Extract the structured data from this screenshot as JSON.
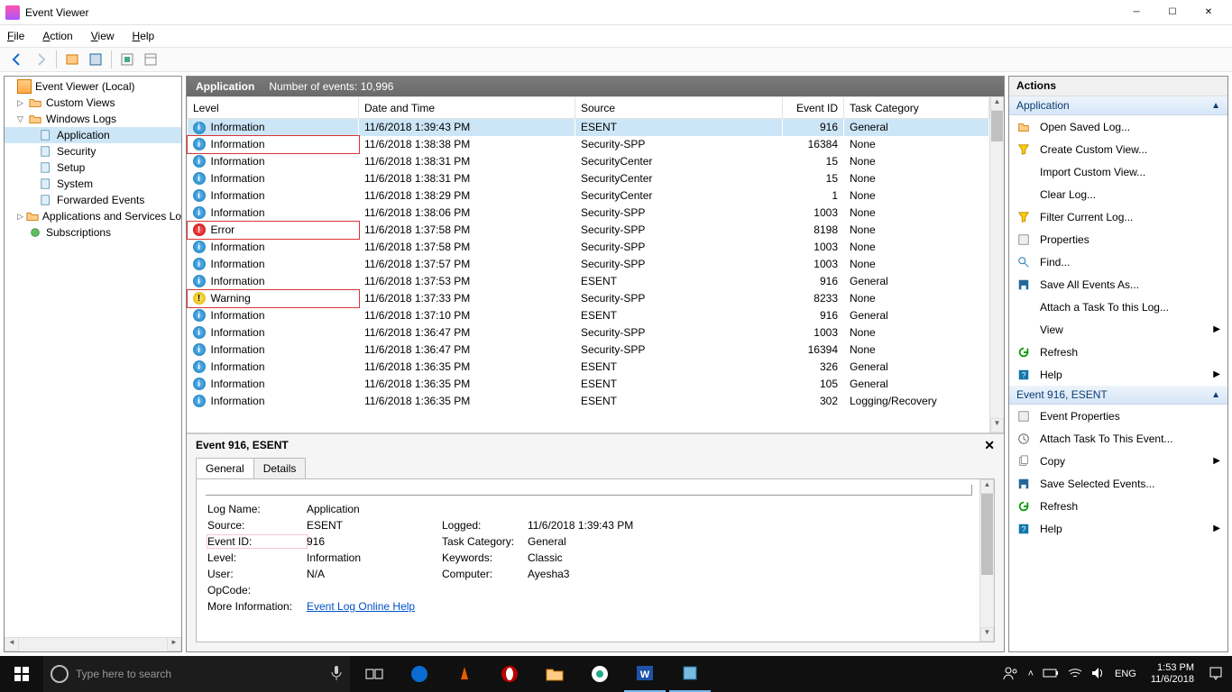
{
  "window": {
    "title": "Event Viewer"
  },
  "menus": {
    "file": "File",
    "action": "Action",
    "view": "View",
    "help": "Help"
  },
  "tree": {
    "root": "Event Viewer (Local)",
    "custom": "Custom Views",
    "winlogs": "Windows Logs",
    "application": "Application",
    "security": "Security",
    "setup": "Setup",
    "system": "System",
    "forwarded": "Forwarded Events",
    "appservices": "Applications and Services Lo",
    "subs": "Subscriptions"
  },
  "list": {
    "name": "Application",
    "count_label": "Number of events: 10,996",
    "cols": {
      "level": "Level",
      "dt": "Date and Time",
      "source": "Source",
      "eid": "Event ID",
      "task": "Task Category"
    },
    "rows": [
      {
        "level": "Information",
        "kind": "info",
        "dt": "11/6/2018 1:39:43 PM",
        "source": "ESENT",
        "eid": "916",
        "task": "General",
        "sel": true
      },
      {
        "level": "Information",
        "kind": "info",
        "dt": "11/6/2018 1:38:38 PM",
        "source": "Security-SPP",
        "eid": "16384",
        "task": "None",
        "red": true
      },
      {
        "level": "Information",
        "kind": "info",
        "dt": "11/6/2018 1:38:31 PM",
        "source": "SecurityCenter",
        "eid": "15",
        "task": "None"
      },
      {
        "level": "Information",
        "kind": "info",
        "dt": "11/6/2018 1:38:31 PM",
        "source": "SecurityCenter",
        "eid": "15",
        "task": "None"
      },
      {
        "level": "Information",
        "kind": "info",
        "dt": "11/6/2018 1:38:29 PM",
        "source": "SecurityCenter",
        "eid": "1",
        "task": "None"
      },
      {
        "level": "Information",
        "kind": "info",
        "dt": "11/6/2018 1:38:06 PM",
        "source": "Security-SPP",
        "eid": "1003",
        "task": "None"
      },
      {
        "level": "Error",
        "kind": "error",
        "dt": "11/6/2018 1:37:58 PM",
        "source": "Security-SPP",
        "eid": "8198",
        "task": "None",
        "red": true
      },
      {
        "level": "Information",
        "kind": "info",
        "dt": "11/6/2018 1:37:58 PM",
        "source": "Security-SPP",
        "eid": "1003",
        "task": "None"
      },
      {
        "level": "Information",
        "kind": "info",
        "dt": "11/6/2018 1:37:57 PM",
        "source": "Security-SPP",
        "eid": "1003",
        "task": "None"
      },
      {
        "level": "Information",
        "kind": "info",
        "dt": "11/6/2018 1:37:53 PM",
        "source": "ESENT",
        "eid": "916",
        "task": "General"
      },
      {
        "level": "Warning",
        "kind": "warn",
        "dt": "11/6/2018 1:37:33 PM",
        "source": "Security-SPP",
        "eid": "8233",
        "task": "None",
        "red": true
      },
      {
        "level": "Information",
        "kind": "info",
        "dt": "11/6/2018 1:37:10 PM",
        "source": "ESENT",
        "eid": "916",
        "task": "General"
      },
      {
        "level": "Information",
        "kind": "info",
        "dt": "11/6/2018 1:36:47 PM",
        "source": "Security-SPP",
        "eid": "1003",
        "task": "None"
      },
      {
        "level": "Information",
        "kind": "info",
        "dt": "11/6/2018 1:36:47 PM",
        "source": "Security-SPP",
        "eid": "16394",
        "task": "None"
      },
      {
        "level": "Information",
        "kind": "info",
        "dt": "11/6/2018 1:36:35 PM",
        "source": "ESENT",
        "eid": "326",
        "task": "General"
      },
      {
        "level": "Information",
        "kind": "info",
        "dt": "11/6/2018 1:36:35 PM",
        "source": "ESENT",
        "eid": "105",
        "task": "General"
      },
      {
        "level": "Information",
        "kind": "info",
        "dt": "11/6/2018 1:36:35 PM",
        "source": "ESENT",
        "eid": "302",
        "task": "Logging/Recovery"
      }
    ]
  },
  "detail": {
    "title": "Event 916, ESENT",
    "tabs": {
      "general": "General",
      "details": "Details"
    },
    "props": {
      "logname_lbl": "Log Name:",
      "logname": "Application",
      "source_lbl": "Source:",
      "source": "ESENT",
      "logged_lbl": "Logged:",
      "logged": "11/6/2018 1:39:43 PM",
      "eid_lbl": "Event ID:",
      "eid": "916",
      "task_lbl": "Task Category:",
      "task": "General",
      "level_lbl": "Level:",
      "level": "Information",
      "kw_lbl": "Keywords:",
      "kw": "Classic",
      "user_lbl": "User:",
      "user": "N/A",
      "comp_lbl": "Computer:",
      "comp": "Ayesha3",
      "op_lbl": "OpCode:",
      "more_lbl": "More Information:",
      "more_link": "Event Log Online Help"
    }
  },
  "actions": {
    "header": "Actions",
    "sec1": "Application",
    "sec2": "Event 916, ESENT",
    "a": {
      "open": "Open Saved Log...",
      "create": "Create Custom View...",
      "import": "Import Custom View...",
      "clear": "Clear Log...",
      "filter": "Filter Current Log...",
      "props": "Properties",
      "find": "Find...",
      "save": "Save All Events As...",
      "attach": "Attach a Task To this Log...",
      "view": "View",
      "refresh": "Refresh",
      "help": "Help",
      "eprops": "Event Properties",
      "eattach": "Attach Task To This Event...",
      "copy": "Copy",
      "savesel": "Save Selected Events...",
      "refresh2": "Refresh",
      "help2": "Help"
    }
  },
  "taskbar": {
    "search": "Type here to search",
    "lang": "ENG",
    "time": "1:53 PM",
    "date": "11/6/2018"
  }
}
